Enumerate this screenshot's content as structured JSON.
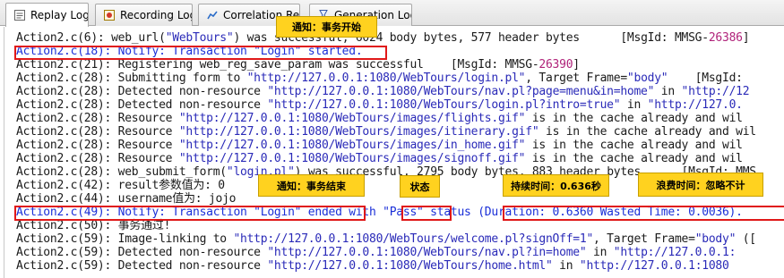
{
  "tabs": [
    {
      "label": "Replay Log",
      "icon": "replay-log-icon",
      "active": true
    },
    {
      "label": "Recording Log",
      "icon": "recording-log-icon",
      "active": false
    },
    {
      "label": "Correlation Results",
      "icon": "correlation-icon",
      "active": false
    },
    {
      "label": "Generation Log",
      "icon": "generation-log-icon",
      "active": false
    }
  ],
  "log_lines": [
    {
      "pre": "Action2.c(6): web_url(",
      "url": "\"WebTours\"",
      "post": ") was successful, 6024 body bytes, 577 header bytes      [MsgId: MMSG-",
      "num": "26386",
      "tail": "]"
    },
    {
      "pre": "Action2.c(18): Notify: Transaction \"Login\" started.",
      "url": "",
      "post": "",
      "num": "",
      "tail": "",
      "highlight": true
    },
    {
      "pre": "Action2.c(21): Registering web_reg_save_param was successful    [MsgId: MMSG-",
      "url": "",
      "post": "",
      "num": "26390",
      "tail": "]"
    },
    {
      "pre": "Action2.c(28): Submitting form to ",
      "url": "\"http://127.0.0.1:1080/WebTours/login.pl\"",
      "post": ", Target Frame=",
      "num": "",
      "tail": "",
      "url2": "\"body\"",
      "tail2": "    [MsgId:"
    },
    {
      "pre": "Action2.c(28): Detected non-resource ",
      "url": "\"http://127.0.0.1:1080/WebTours/nav.pl?page=menu&in=home\"",
      "post": " in ",
      "num": "",
      "tail": "",
      "url2": "\"http://12"
    },
    {
      "pre": "Action2.c(28): Detected non-resource ",
      "url": "\"http://127.0.0.1:1080/WebTours/login.pl?intro=true\"",
      "post": " in ",
      "num": "",
      "tail": "",
      "url2": "\"http://127.0."
    },
    {
      "pre": "Action2.c(28): Resource ",
      "url": "\"http://127.0.0.1:1080/WebTours/images/flights.gif\"",
      "post": " is in the cache already and wil",
      "num": "",
      "tail": ""
    },
    {
      "pre": "Action2.c(28): Resource ",
      "url": "\"http://127.0.0.1:1080/WebTours/images/itinerary.gif\"",
      "post": " is in the cache already and wil",
      "num": "",
      "tail": ""
    },
    {
      "pre": "Action2.c(28): Resource ",
      "url": "\"http://127.0.0.1:1080/WebTours/images/in_home.gif\"",
      "post": " is in the cache already and wil",
      "num": "",
      "tail": ""
    },
    {
      "pre": "Action2.c(28): Resource ",
      "url": "\"http://127.0.0.1:1080/WebTours/images/signoff.gif\"",
      "post": " is in the cache already and wil",
      "num": "",
      "tail": ""
    },
    {
      "pre": "Action2.c(28): web_submit_form(",
      "url": "\"login.pl\"",
      "post": ") was successful, 2795 body bytes, 883 header bytes      [MsgId: MMS",
      "num": "",
      "tail": ""
    },
    {
      "pre": "Action2.c(42): result参数值为: 0",
      "url": "",
      "post": "",
      "num": "",
      "tail": ""
    },
    {
      "pre": "Action2.c(44): username值为: jojo",
      "url": "",
      "post": "",
      "num": "",
      "tail": ""
    },
    {
      "pre": "Action2.c(49): Notify: Transaction \"Login\" ended with \"Pass\" status (Duration: 0.6360 Wasted Time: 0.0036).",
      "url": "",
      "post": "",
      "num": "",
      "tail": "",
      "highlight": true
    },
    {
      "pre": "Action2.c(50): 事务通过!",
      "url": "",
      "post": "",
      "num": "",
      "tail": ""
    },
    {
      "pre": "Action2.c(59): Image-linking to ",
      "url": "\"http://127.0.0.1:1080/WebTours/welcome.pl?signOff=1\"",
      "post": ", Target Frame=",
      "num": "",
      "tail": "",
      "url2": "\"body\"",
      "tail2": " (["
    },
    {
      "pre": "Action2.c(59): Detected non-resource ",
      "url": "\"http://127.0.0.1:1080/WebTours/nav.pl?in=home\"",
      "post": " in ",
      "num": "",
      "tail": "",
      "url2": "\"http://127.0.0.1:"
    },
    {
      "pre": "Action2.c(59): Detected non-resource ",
      "url": "\"http://127.0.0.1:1080/WebTours/home.html\"",
      "post": " in ",
      "num": "",
      "tail": "",
      "url2": "\"http://127.0.0.1:1080"
    }
  ],
  "annotations": {
    "start_note": "通知：事务开始",
    "end_note": "通知：事务结束",
    "status_note": "状态",
    "duration_note": "持续时间：0.636秒",
    "wasted_note": "浪费时间：忽略不计"
  },
  "colors": {
    "note_bg": "#ffd21f",
    "box_red": "#e01818",
    "url_blue": "#2a2ab8",
    "msg_magenta": "#b0237a"
  }
}
